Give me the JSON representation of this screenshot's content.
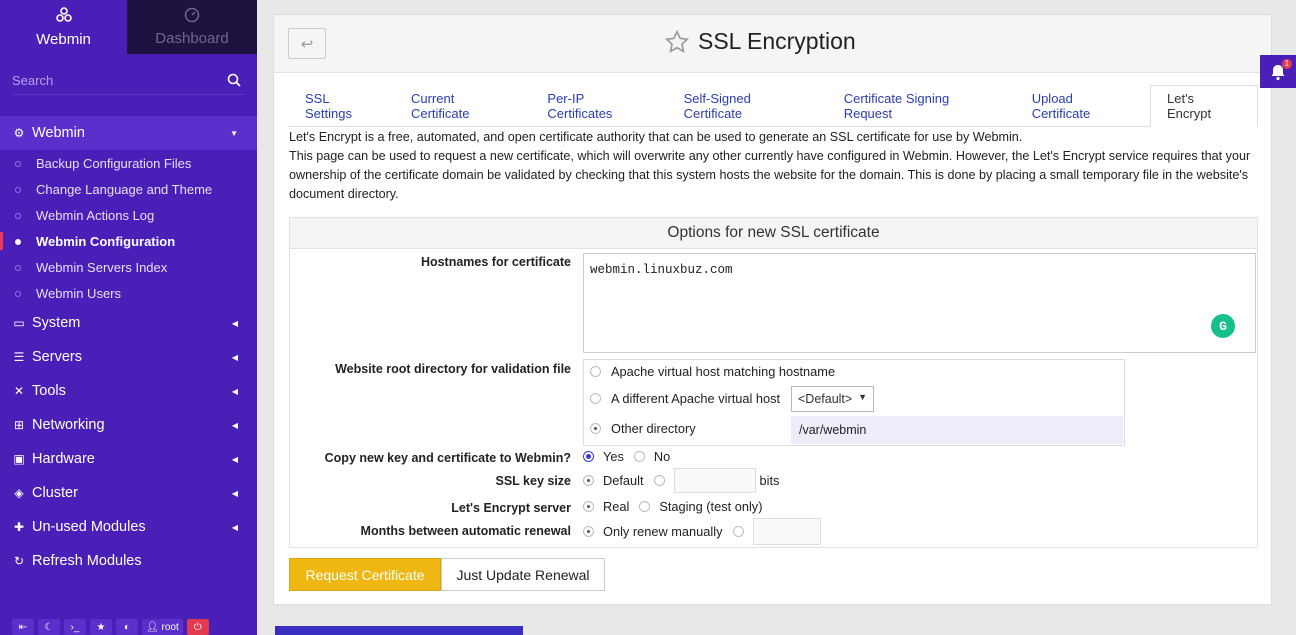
{
  "sidebar": {
    "tab_webmin": "Webmin",
    "tab_dashboard": "Dashboard",
    "search_placeholder": "Search",
    "categories": [
      {
        "label": "Webmin"
      },
      {
        "label": "System"
      },
      {
        "label": "Servers"
      },
      {
        "label": "Tools"
      },
      {
        "label": "Networking"
      },
      {
        "label": "Hardware"
      },
      {
        "label": "Cluster"
      },
      {
        "label": "Un-used Modules"
      },
      {
        "label": "Refresh Modules"
      }
    ],
    "webmin_items": [
      "Backup Configuration Files",
      "Change Language and Theme",
      "Webmin Actions Log",
      "Webmin Configuration",
      "Webmin Servers Index",
      "Webmin Users"
    ],
    "user": "root"
  },
  "header": {
    "back_symbol": "↩",
    "title": "SSL Encryption"
  },
  "tabs": [
    "SSL Settings",
    "Current Certificate",
    "Per-IP Certificates",
    "Self-Signed Certificate",
    "Certificate Signing Request",
    "Upload Certificate",
    "Let's Encrypt"
  ],
  "description": {
    "line1": "Let's Encrypt is a free, automated, and open certificate authority that can be used to generate an SSL certificate for use by Webmin.",
    "line2": "This page can be used to request a new certificate, which will overwrite any other currently have configured in Webmin. However, the Let's Encrypt service requires that your ownership of the certificate domain be validated by checking that this system hosts the website for the domain. This is done by placing a small temporary file in the website's document directory."
  },
  "options": {
    "heading": "Options for new SSL certificate",
    "hostnames_label": "Hostnames for certificate",
    "hostnames_value": "webmin.linuxbuz.com",
    "webroot_label": "Website root directory for validation file",
    "webroot_opt1": "Apache virtual host matching hostname",
    "webroot_opt2": "A different Apache virtual host",
    "webroot_select": "<Default>",
    "webroot_opt3": "Other directory",
    "webroot_dir": "/var/webmin",
    "copy_label": "Copy new key and certificate to Webmin?",
    "copy_yes": "Yes",
    "copy_no": "No",
    "keysize_label": "SSL key size",
    "keysize_default": "Default",
    "keysize_unit": "bits",
    "server_label": "Let's Encrypt server",
    "server_real": "Real",
    "server_staging": "Staging (test only)",
    "renewal_label": "Months between automatic renewal",
    "renewal_manual": "Only renew manually"
  },
  "buttons": {
    "request": "Request Certificate",
    "update": "Just Update Renewal"
  },
  "notifications": {
    "count": "1"
  }
}
